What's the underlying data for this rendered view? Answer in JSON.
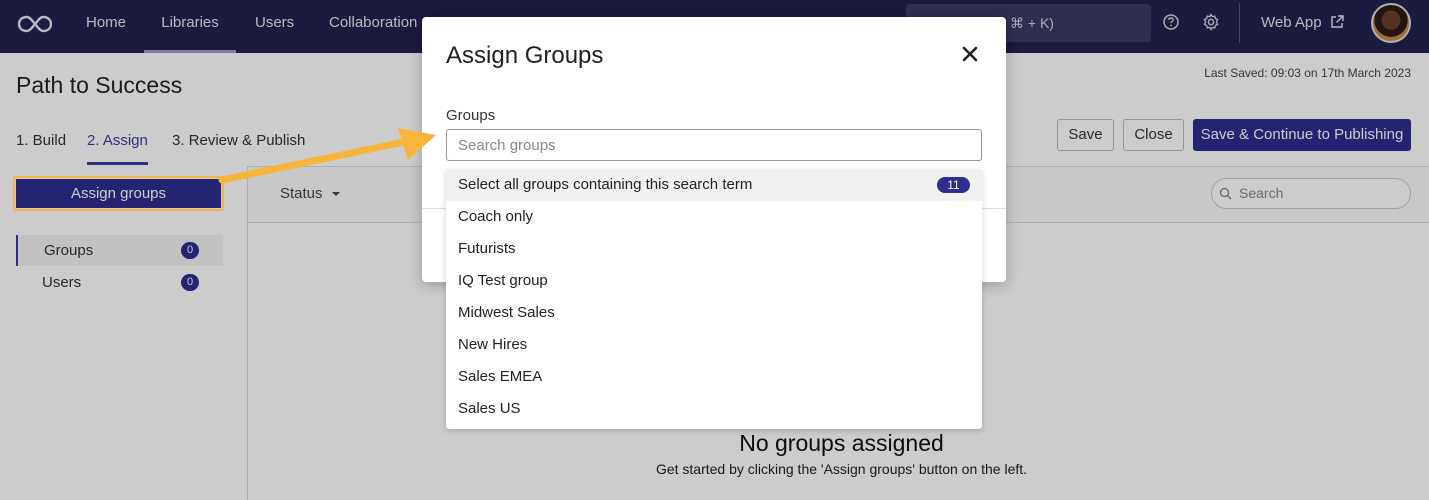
{
  "nav": {
    "items": [
      {
        "label": "Home"
      },
      {
        "label": "Libraries"
      },
      {
        "label": "Users"
      },
      {
        "label": "Collaboration"
      }
    ],
    "search_shortcut": "⌘ + K)",
    "webapp_label": "Web App"
  },
  "page": {
    "title": "Path to Success",
    "last_saved": "Last Saved: 09:03 on 17th March 2023",
    "tabs": [
      {
        "label": "1. Build"
      },
      {
        "label": "2. Assign"
      },
      {
        "label": "3. Review & Publish"
      }
    ],
    "save_label": "Save",
    "close_label": "Close",
    "continue_label": "Save & Continue to Publishing",
    "assign_groups_label": "Assign groups",
    "sidebar": [
      {
        "label": "Groups",
        "count": "0"
      },
      {
        "label": "Users",
        "count": "0"
      }
    ],
    "status_filter": "Status",
    "search_placeholder": "Search",
    "empty_title": "No groups assigned",
    "empty_subtitle": "Get started by clicking the 'Assign groups' button on the left."
  },
  "modal": {
    "title": "Assign Groups",
    "groups_label": "Groups",
    "search_placeholder": "Search groups",
    "dropdown": {
      "select_all_label": "Select all groups containing this search term",
      "select_all_count": "11",
      "options": [
        {
          "label": "Coach only"
        },
        {
          "label": "Futurists"
        },
        {
          "label": "IQ Test group"
        },
        {
          "label": "Midwest Sales"
        },
        {
          "label": "New Hires"
        },
        {
          "label": "Sales EMEA"
        },
        {
          "label": "Sales US"
        }
      ]
    }
  },
  "colors": {
    "nav_bg": "#22214f",
    "primary": "#2e2e8f",
    "annotation": "#f7b53b"
  }
}
